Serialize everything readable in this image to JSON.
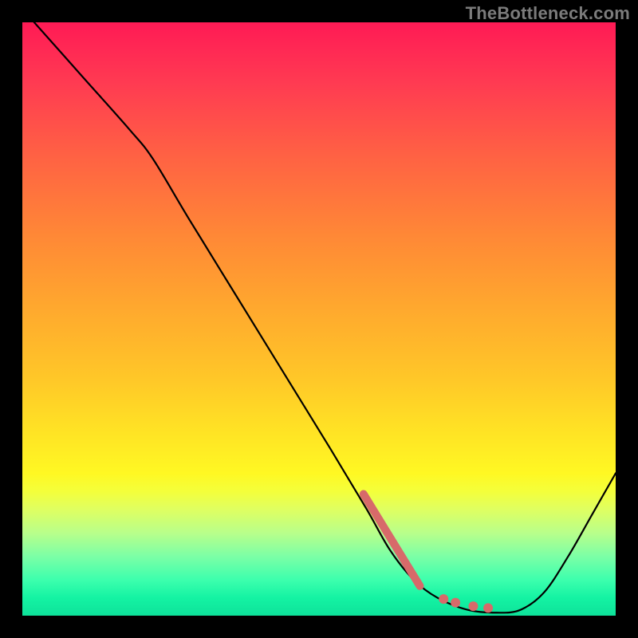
{
  "watermark": "TheBottleneck.com",
  "colors": {
    "black": "#000000",
    "highlight": "#d76a6a"
  },
  "chart_data": {
    "type": "line",
    "title": "",
    "xlabel": "",
    "ylabel": "",
    "xlim": [
      0,
      100
    ],
    "ylim": [
      0,
      100
    ],
    "grid": false,
    "legend": false,
    "curve_points_xy": [
      [
        2,
        100
      ],
      [
        10,
        91
      ],
      [
        18,
        82
      ],
      [
        22,
        77
      ],
      [
        28,
        67
      ],
      [
        36,
        54
      ],
      [
        44,
        41
      ],
      [
        52,
        28
      ],
      [
        58,
        18
      ],
      [
        62,
        11
      ],
      [
        66,
        6
      ],
      [
        70,
        3
      ],
      [
        75,
        1
      ],
      [
        80,
        0.5
      ],
      [
        84,
        1
      ],
      [
        88,
        4
      ],
      [
        92,
        10
      ],
      [
        96,
        17
      ],
      [
        100,
        24
      ]
    ],
    "highlight_segment_xy": [
      [
        57.5,
        20.5
      ],
      [
        67,
        5
      ]
    ],
    "highlight_dots_xy": [
      [
        71,
        2.8
      ],
      [
        73,
        2.2
      ],
      [
        76,
        1.6
      ],
      [
        78.5,
        1.3
      ]
    ]
  }
}
